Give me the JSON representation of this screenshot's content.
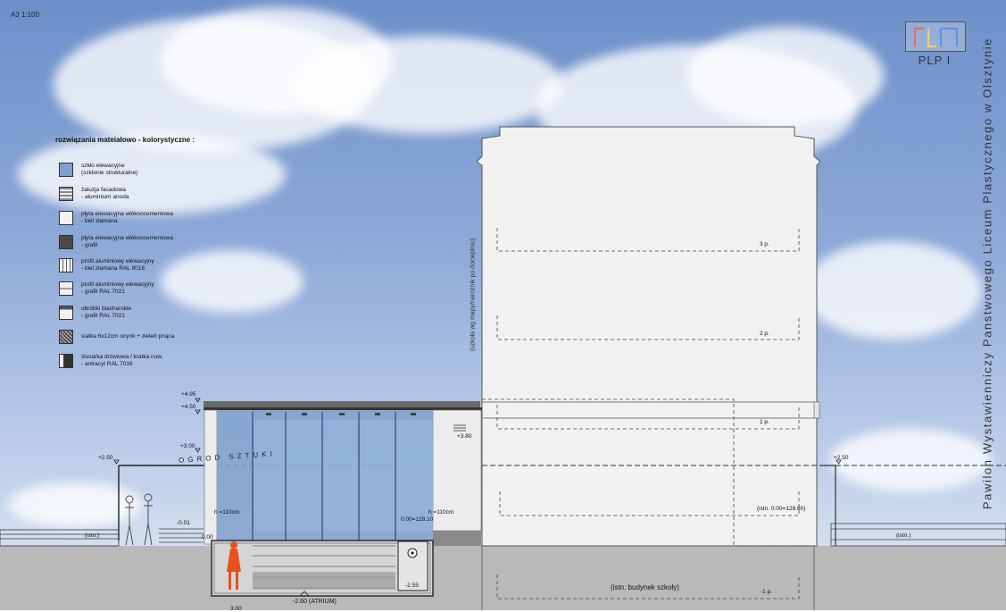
{
  "sheet": {
    "scale_label": "A3 1:100"
  },
  "logo": {
    "text": "PLP I"
  },
  "project_title": "Pawilon Wystawienniczy Panstwowego Liceum Plastycznego w Olsztynie",
  "legend": {
    "title": "rozwiązania mateiałowo - kolorystyczne :",
    "items": [
      {
        "text": "szkło elewacyjne\n(szklenie strukturalne)",
        "icon": "glass-swatch-icon"
      },
      {
        "text": "żaluzja fasadowa\n- aluminium anoda",
        "icon": "louvre-swatch-icon"
      },
      {
        "text": "płyta elewacyjna włóknocementowa\n- biel złamana",
        "icon": "white-panel-swatch-icon"
      },
      {
        "text": "płyta elewacyjna włóknocementowa\n- grafit",
        "icon": "graphite-panel-swatch-icon"
      },
      {
        "text": "profil aluminiowy elewacyjny\n- biel złamana RAL 9018",
        "icon": "white-profile-swatch-icon"
      },
      {
        "text": "profil aluminiowy elewacyjny\n- grafit RAL 7021",
        "icon": "graphite-profile-swatch-icon"
      },
      {
        "text": "obróbki blacharskie\n- grafit RAL 7021",
        "icon": "flashing-swatch-icon"
      },
      {
        "text": "siatka 6x12cm ocynk + zieleń pnąca",
        "icon": "mesh-swatch-icon"
      },
      {
        "text": "ślusarka drzwiowa / kratka nuw.\n- antracyt RAL 7016",
        "icon": "door-swatch-icon"
      }
    ]
  },
  "levels": {
    "pav_top": "+4.95",
    "pav_eave": "+4.50",
    "pav_300": "+3.00",
    "wall_left": "+2.50",
    "wall_right": "+2.50",
    "vent": "+3.80",
    "neg_001": "-0.01",
    "ground_left": "0.00",
    "zero_abs": "0.00=128.10",
    "atrium_floor": "-2.55",
    "atrium": "-2.60 (ATRIUM)",
    "istn_zero": "(istn. 0.00=128.60)",
    "h_left": "h =110cm",
    "h_right": "h =110cm",
    "istn_left": "(istn.)",
    "istn_right": "(istn.)",
    "floor_3": "3 p.",
    "floor_2": "2 p.",
    "floor_1": "1 p.",
    "floor_m1": "-1 p.",
    "bottom_num": "3.00"
  },
  "labels": {
    "garden": "OGROD SZTUKI",
    "vertical_note": "(szkoła wg mapy/narożnik po docieplniu)",
    "existing_school": "(istn. budynek szkoły)"
  },
  "colors": {
    "sky_top": "#6d8fc9",
    "ground": "#b9b9b9",
    "glass": "#7fa0cc",
    "figure_orange": "#e8501c",
    "logo_red": "#e23b2e",
    "logo_yellow": "#f0c419",
    "logo_blue": "#2c6fd1"
  }
}
